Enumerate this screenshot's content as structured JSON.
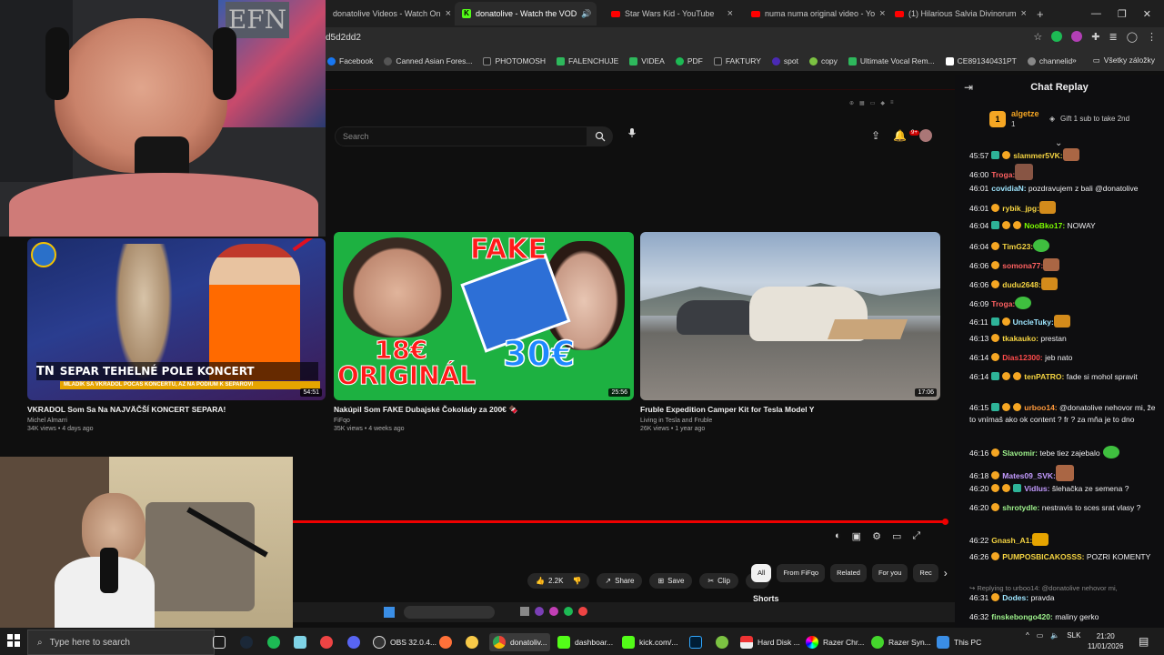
{
  "browser": {
    "tabs": [
      {
        "title": "donatolive Videos - Watch On",
        "favicon": "youtube"
      },
      {
        "title": "donatolive - Watch the VOD",
        "favicon": "kick",
        "active": true
      },
      {
        "title": "Star Wars Kid - YouTube",
        "favicon": "youtube"
      },
      {
        "title": "numa numa original video - Yo",
        "favicon": "youtube"
      },
      {
        "title": "(1) Hilarious Salvia Divinorum",
        "favicon": "youtube"
      }
    ],
    "url": "d5d2dd2",
    "bookmarks": [
      "Facebook",
      "Canned Asian Fores...",
      "PHOTOMOSH",
      "FALENCHUJE",
      "VIDEA",
      "PDF",
      "FAKTURY",
      "spot",
      "copy",
      "Ultimate Vocal Rem...",
      "CE891340431PT",
      "channelid"
    ],
    "all_bookmarks": "Všetky záložky"
  },
  "youtube": {
    "search_placeholder": "Search",
    "notif_count": "9+",
    "videos": [
      {
        "title": "VKRADOL Som Sa Na NAJVÄČŠÍ KONCERT SEPARA!",
        "channel": "Michel Almarri",
        "meta": "34K views • 4 days ago",
        "duration": "54:51",
        "thumb_text": "SEPAR TEHELNÉ POLE KONCERT",
        "thumb_sub": "MLADÍK SA VKRADOL POČAS KONCERTU, AŽ NA PÓDIUM K SEPAROVI",
        "thumb_logo": "TN"
      },
      {
        "title": "Nakúpil Som FAKE Dubajské Čokolády za 200€ 🍫",
        "channel": "FiFqo",
        "meta": "35K views • 4 weeks ago",
        "duration": "25:56",
        "thumb_top": "FAKE",
        "thumb_left": "18€ ORIGINÁL",
        "thumb_right": "30€"
      },
      {
        "title": "Fruble Expedition Camper Kit for Tesla Model Y",
        "channel": "Living in Tesla and Fruble",
        "meta": "26K views • 1 year ago",
        "duration": "17:06"
      }
    ],
    "actions": {
      "likes": "2.2K",
      "share": "Share",
      "save": "Save",
      "clip": "Clip"
    },
    "chips": [
      "All",
      "From FiFqo",
      "Related",
      "For you",
      "Rec"
    ],
    "shorts": "Shorts"
  },
  "chat": {
    "title": "Chat Replay",
    "pinned": {
      "user": "algetze",
      "count": "1",
      "gift": "Gift 1 sub to take 2nd"
    },
    "messages": [
      {
        "time": "45:57",
        "user": "slammer5VK:",
        "color": "#f5d442",
        "text": ""
      },
      {
        "time": "46:00",
        "user": "Troga:",
        "color": "#ff6161",
        "text": ""
      },
      {
        "time": "46:01",
        "user": "covidiaN:",
        "color": "#9ee6ff",
        "text": "pozdravujem z bali @donatolive"
      },
      {
        "time": "46:01",
        "user": "rybik_jpg:",
        "color": "#f5d442",
        "text": ""
      },
      {
        "time": "46:04",
        "user": "NooBko17:",
        "color": "#7cfc00",
        "text": "NOWAY"
      },
      {
        "time": "46:04",
        "user": "TimG23:",
        "color": "#f5d442",
        "text": ""
      },
      {
        "time": "46:06",
        "user": "somona77:",
        "color": "#ff6161",
        "text": ""
      },
      {
        "time": "46:06",
        "user": "dudu2648:",
        "color": "#f5d442",
        "text": ""
      },
      {
        "time": "46:09",
        "user": "Troga:",
        "color": "#ff6161",
        "text": ""
      },
      {
        "time": "46:11",
        "user": "UncleTuky:",
        "color": "#9ee6ff",
        "text": ""
      },
      {
        "time": "46:13",
        "user": "tkakauko:",
        "color": "#f5d442",
        "text": "prestan"
      },
      {
        "time": "46:14",
        "user": "Dias12300:",
        "color": "#ff4b4b",
        "text": "jeb nato"
      },
      {
        "time": "46:14",
        "user": "tenPATRO:",
        "color": "#f5d442",
        "text": "fade si mohol spravit"
      },
      {
        "time": "46:15",
        "user": "urboo14:",
        "color": "#ff9a3c",
        "text": "@donatolive nehovor mi, že to vnímaš ako ok content ? fr ? za mňa je to dno"
      },
      {
        "time": "46:16",
        "user": "Slavomir:",
        "color": "#9ef28c",
        "text": "tebe tiez zajebalo"
      },
      {
        "time": "46:18",
        "user": "Mates09_SVK:",
        "color": "#c39bff",
        "text": ""
      },
      {
        "time": "46:20",
        "user": "Vidlus:",
        "color": "#c39bff",
        "text": "šlehačka ze semena ?"
      },
      {
        "time": "46:20",
        "user": "shrotydle:",
        "color": "#9ef28c",
        "text": "nestravis to sces srat vlasy ?"
      },
      {
        "time": "46:22",
        "user": "Gnash_A1:",
        "color": "#f5d442",
        "text": ""
      },
      {
        "time": "46:26",
        "user": "PUMPOSBICAKOSSS:",
        "color": "#f5d442",
        "text": "POZRI KOMENTY"
      },
      {
        "time": "46:31",
        "user": "Dodes:",
        "color": "#9ee6ff",
        "text": "pravda"
      },
      {
        "time": "46:32",
        "user": "finskebongo420:",
        "color": "#9ef28c",
        "text": "maliny gerko"
      }
    ],
    "reply_note": "Replying to urboo14: @donatolive nehovor mi,"
  },
  "taskbar": {
    "search_placeholder": "Type here to search",
    "apps": [
      "OBS 32.0.4...",
      "donatoliv...",
      "dashboar...",
      "kick.com/...",
      "Hard Disk ...",
      "Razer Chr...",
      "Razer Syn...",
      "This PC"
    ],
    "tray": {
      "lang": "SLK",
      "time": "21:20",
      "date": "11/01/2026"
    }
  },
  "colors": {
    "accent_red": "#ff0000",
    "kick_green": "#53fc18",
    "chat_bg": "#0e0e10"
  }
}
